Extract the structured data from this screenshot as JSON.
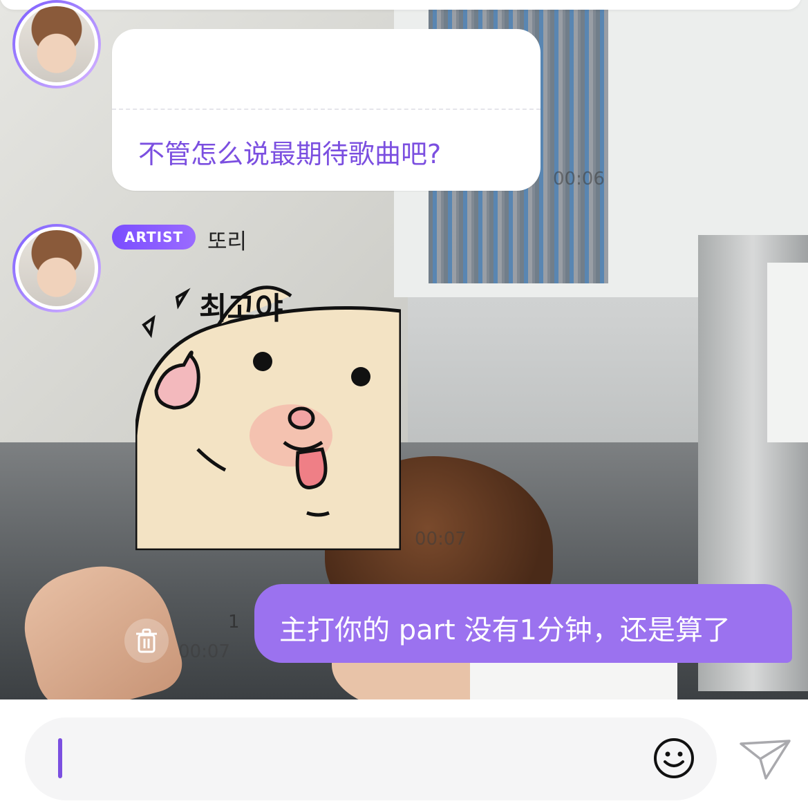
{
  "messages": [
    {
      "badge": "ARTIST",
      "nickname": "또리",
      "quote_text": "",
      "reply_text": "不管怎么说最期待歌曲吧?",
      "time": "00:06"
    },
    {
      "badge": "ARTIST",
      "nickname": "또리",
      "sticker_caption": "최고야",
      "time": "00:07"
    }
  ],
  "my_message": {
    "text": "主打你的 part 没有1分钟，还是算了",
    "unread_count": "1",
    "time": "00:07"
  },
  "input": {
    "value": "",
    "placeholder": ""
  },
  "icons": {
    "delete": "trash-icon",
    "emoji": "smiley-icon",
    "send": "paper-plane-icon"
  },
  "colors": {
    "accent": "#7b4fe0",
    "my_bubble": "#9b72ef",
    "badge": "#7a4dff"
  }
}
